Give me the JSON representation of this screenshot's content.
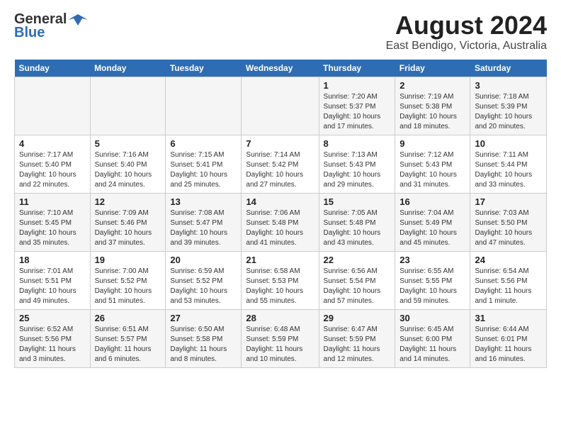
{
  "logo": {
    "general": "General",
    "blue": "Blue"
  },
  "title": "August 2024",
  "subtitle": "East Bendigo, Victoria, Australia",
  "days_of_week": [
    "Sunday",
    "Monday",
    "Tuesday",
    "Wednesday",
    "Thursday",
    "Friday",
    "Saturday"
  ],
  "weeks": [
    [
      {
        "day": "",
        "info": ""
      },
      {
        "day": "",
        "info": ""
      },
      {
        "day": "",
        "info": ""
      },
      {
        "day": "",
        "info": ""
      },
      {
        "day": "1",
        "info": "Sunrise: 7:20 AM\nSunset: 5:37 PM\nDaylight: 10 hours and 17 minutes."
      },
      {
        "day": "2",
        "info": "Sunrise: 7:19 AM\nSunset: 5:38 PM\nDaylight: 10 hours and 18 minutes."
      },
      {
        "day": "3",
        "info": "Sunrise: 7:18 AM\nSunset: 5:39 PM\nDaylight: 10 hours and 20 minutes."
      }
    ],
    [
      {
        "day": "4",
        "info": "Sunrise: 7:17 AM\nSunset: 5:40 PM\nDaylight: 10 hours and 22 minutes."
      },
      {
        "day": "5",
        "info": "Sunrise: 7:16 AM\nSunset: 5:40 PM\nDaylight: 10 hours and 24 minutes."
      },
      {
        "day": "6",
        "info": "Sunrise: 7:15 AM\nSunset: 5:41 PM\nDaylight: 10 hours and 25 minutes."
      },
      {
        "day": "7",
        "info": "Sunrise: 7:14 AM\nSunset: 5:42 PM\nDaylight: 10 hours and 27 minutes."
      },
      {
        "day": "8",
        "info": "Sunrise: 7:13 AM\nSunset: 5:43 PM\nDaylight: 10 hours and 29 minutes."
      },
      {
        "day": "9",
        "info": "Sunrise: 7:12 AM\nSunset: 5:43 PM\nDaylight: 10 hours and 31 minutes."
      },
      {
        "day": "10",
        "info": "Sunrise: 7:11 AM\nSunset: 5:44 PM\nDaylight: 10 hours and 33 minutes."
      }
    ],
    [
      {
        "day": "11",
        "info": "Sunrise: 7:10 AM\nSunset: 5:45 PM\nDaylight: 10 hours and 35 minutes."
      },
      {
        "day": "12",
        "info": "Sunrise: 7:09 AM\nSunset: 5:46 PM\nDaylight: 10 hours and 37 minutes."
      },
      {
        "day": "13",
        "info": "Sunrise: 7:08 AM\nSunset: 5:47 PM\nDaylight: 10 hours and 39 minutes."
      },
      {
        "day": "14",
        "info": "Sunrise: 7:06 AM\nSunset: 5:48 PM\nDaylight: 10 hours and 41 minutes."
      },
      {
        "day": "15",
        "info": "Sunrise: 7:05 AM\nSunset: 5:48 PM\nDaylight: 10 hours and 43 minutes."
      },
      {
        "day": "16",
        "info": "Sunrise: 7:04 AM\nSunset: 5:49 PM\nDaylight: 10 hours and 45 minutes."
      },
      {
        "day": "17",
        "info": "Sunrise: 7:03 AM\nSunset: 5:50 PM\nDaylight: 10 hours and 47 minutes."
      }
    ],
    [
      {
        "day": "18",
        "info": "Sunrise: 7:01 AM\nSunset: 5:51 PM\nDaylight: 10 hours and 49 minutes."
      },
      {
        "day": "19",
        "info": "Sunrise: 7:00 AM\nSunset: 5:52 PM\nDaylight: 10 hours and 51 minutes."
      },
      {
        "day": "20",
        "info": "Sunrise: 6:59 AM\nSunset: 5:52 PM\nDaylight: 10 hours and 53 minutes."
      },
      {
        "day": "21",
        "info": "Sunrise: 6:58 AM\nSunset: 5:53 PM\nDaylight: 10 hours and 55 minutes."
      },
      {
        "day": "22",
        "info": "Sunrise: 6:56 AM\nSunset: 5:54 PM\nDaylight: 10 hours and 57 minutes."
      },
      {
        "day": "23",
        "info": "Sunrise: 6:55 AM\nSunset: 5:55 PM\nDaylight: 10 hours and 59 minutes."
      },
      {
        "day": "24",
        "info": "Sunrise: 6:54 AM\nSunset: 5:56 PM\nDaylight: 11 hours and 1 minute."
      }
    ],
    [
      {
        "day": "25",
        "info": "Sunrise: 6:52 AM\nSunset: 5:56 PM\nDaylight: 11 hours and 3 minutes."
      },
      {
        "day": "26",
        "info": "Sunrise: 6:51 AM\nSunset: 5:57 PM\nDaylight: 11 hours and 6 minutes."
      },
      {
        "day": "27",
        "info": "Sunrise: 6:50 AM\nSunset: 5:58 PM\nDaylight: 11 hours and 8 minutes."
      },
      {
        "day": "28",
        "info": "Sunrise: 6:48 AM\nSunset: 5:59 PM\nDaylight: 11 hours and 10 minutes."
      },
      {
        "day": "29",
        "info": "Sunrise: 6:47 AM\nSunset: 5:59 PM\nDaylight: 11 hours and 12 minutes."
      },
      {
        "day": "30",
        "info": "Sunrise: 6:45 AM\nSunset: 6:00 PM\nDaylight: 11 hours and 14 minutes."
      },
      {
        "day": "31",
        "info": "Sunrise: 6:44 AM\nSunset: 6:01 PM\nDaylight: 11 hours and 16 minutes."
      }
    ]
  ]
}
